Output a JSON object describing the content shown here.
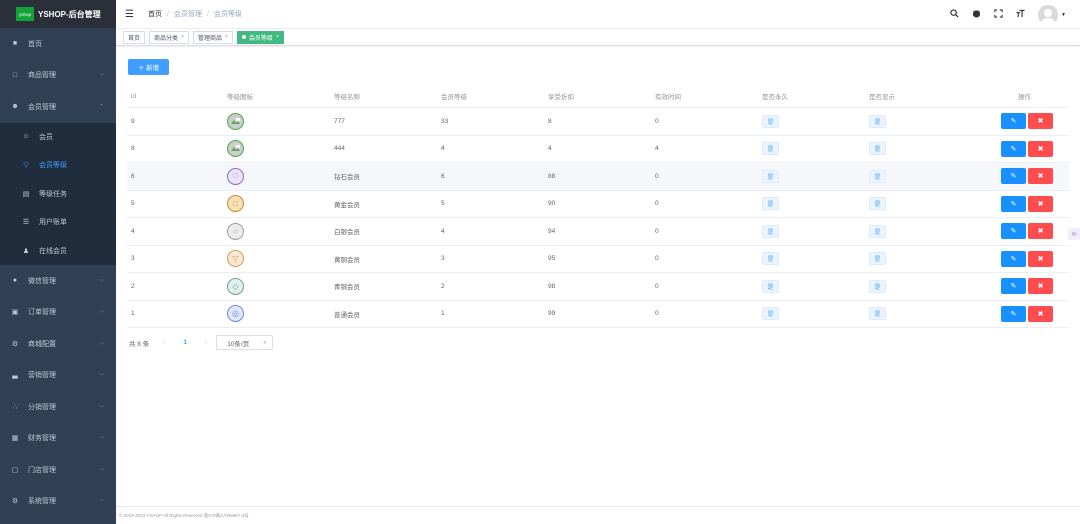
{
  "app": {
    "logo_badge": "yshop",
    "title": "YSHOP-后台管理"
  },
  "sidebar": {
    "items": [
      {
        "label": "首页",
        "icon": "dashboard-icon",
        "glyph": "■",
        "arrow": ""
      },
      {
        "label": "商品管理",
        "icon": "goods-icon",
        "glyph": "□",
        "arrow": "⌵"
      },
      {
        "label": "会员管理",
        "icon": "members-icon",
        "glyph": "☻",
        "arrow": "⌃"
      }
    ],
    "submenu": [
      {
        "label": "会员",
        "icon": "member-icon",
        "glyph": "☺"
      },
      {
        "label": "会员等级",
        "icon": "level-icon",
        "glyph": "▽"
      },
      {
        "label": "等级任务",
        "icon": "task-icon",
        "glyph": "▤"
      },
      {
        "label": "用户账单",
        "icon": "bill-icon",
        "glyph": "☰"
      },
      {
        "label": "在线会员",
        "icon": "online-icon",
        "glyph": "♟"
      }
    ],
    "items_after": [
      {
        "label": "微信管理",
        "icon": "wechat-icon",
        "glyph": "●"
      },
      {
        "label": "订单管理",
        "icon": "order-icon",
        "glyph": "▣"
      },
      {
        "label": "商城配置",
        "icon": "settings-icon",
        "glyph": "⚙"
      },
      {
        "label": "营销管理",
        "icon": "marketing-icon",
        "glyph": "▃"
      },
      {
        "label": "分销管理",
        "icon": "share-icon",
        "glyph": "∴"
      },
      {
        "label": "财务管理",
        "icon": "finance-icon",
        "glyph": "▦"
      },
      {
        "label": "门店管理",
        "icon": "store-icon",
        "glyph": "▢"
      },
      {
        "label": "系统管理",
        "icon": "system-icon",
        "glyph": "⚙"
      }
    ],
    "chevron": "⌵"
  },
  "breadcrumb": {
    "home": "首页",
    "parent": "会员管理",
    "current": "会员等级",
    "sep": "/"
  },
  "tags": [
    {
      "label": "首页",
      "closable": false
    },
    {
      "label": "商品分类",
      "closable": true
    },
    {
      "label": "管理商品",
      "closable": true
    },
    {
      "label": "会员等级",
      "closable": true,
      "active": true
    }
  ],
  "toolbar": {
    "add_label": "＋ 新增"
  },
  "table": {
    "headers": [
      "id",
      "等级图标",
      "等级名称",
      "会员等级",
      "享受折扣",
      "有效时间",
      "是否永久",
      "是否显示",
      "操作"
    ],
    "rows": [
      {
        "id": "9",
        "name": "777",
        "grade": "33",
        "discount": "8",
        "valid": "0",
        "forever": "是",
        "show": "是",
        "icon": "broken-image",
        "hl": false
      },
      {
        "id": "8",
        "name": "444",
        "grade": "4",
        "discount": "4",
        "valid": "4",
        "forever": "是",
        "show": "是",
        "icon": "broken-image",
        "hl": false
      },
      {
        "id": "6",
        "name": "钻石会员",
        "grade": "6",
        "discount": "88",
        "valid": "0",
        "forever": "是",
        "show": "是",
        "icon": "diamond",
        "hl": true
      },
      {
        "id": "5",
        "name": "黄金会员",
        "grade": "5",
        "discount": "90",
        "valid": "0",
        "forever": "是",
        "show": "是",
        "icon": "gold",
        "hl": false
      },
      {
        "id": "4",
        "name": "白银会员",
        "grade": "4",
        "discount": "94",
        "valid": "0",
        "forever": "是",
        "show": "是",
        "icon": "silver",
        "hl": false
      },
      {
        "id": "3",
        "name": "黄铜会员",
        "grade": "3",
        "discount": "95",
        "valid": "0",
        "forever": "是",
        "show": "是",
        "icon": "bronze",
        "hl": false
      },
      {
        "id": "2",
        "name": "青铜会员",
        "grade": "2",
        "discount": "98",
        "valid": "0",
        "forever": "是",
        "show": "是",
        "icon": "cyan",
        "hl": false
      },
      {
        "id": "1",
        "name": "普通会员",
        "grade": "1",
        "discount": "99",
        "valid": "0",
        "forever": "是",
        "show": "是",
        "icon": "normal",
        "hl": false
      }
    ]
  },
  "pagination": {
    "total": "共 8 条",
    "page": "1",
    "page_size": "10条/页",
    "prev": "‹",
    "next": "›"
  },
  "footer": {
    "text": "© 2018-2023 YSHOP All Rights Reserved  浙ICP备17049887-2号"
  },
  "colors": {
    "primary": "#409eff",
    "success": "#42b983",
    "danger": "#ff4d4f",
    "sidebar": "#304156"
  }
}
